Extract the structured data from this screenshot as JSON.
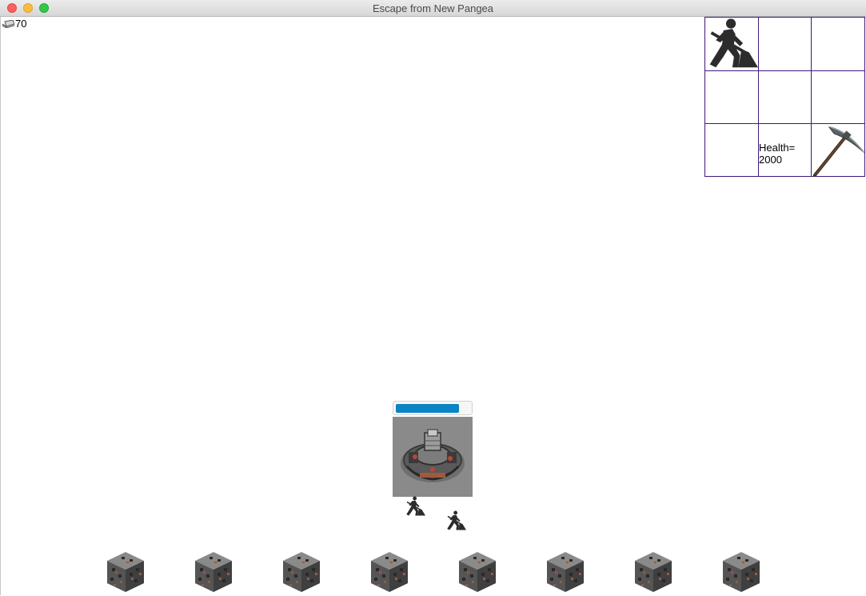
{
  "window": {
    "title": "Escape from New Pangea"
  },
  "hud": {
    "resource_icon": "metal-ingot-icon",
    "resource_count": "70"
  },
  "command_panel": {
    "worker_icon": "worker-shovel-icon",
    "health_label": "Health=",
    "health_value": "2000",
    "pickaxe_icon": "pickaxe-icon"
  },
  "base": {
    "health_fraction": 0.84,
    "bar_color": "#0a84c4",
    "image": "command-center-sprite"
  },
  "units": {
    "workers": [
      {
        "icon": "worker-shovel-icon"
      },
      {
        "icon": "worker-shovel-icon"
      }
    ]
  },
  "ore_blocks": [
    {
      "icon": "ore-block-icon"
    },
    {
      "icon": "ore-block-icon"
    },
    {
      "icon": "ore-block-icon"
    },
    {
      "icon": "ore-block-icon"
    },
    {
      "icon": "ore-block-icon"
    },
    {
      "icon": "ore-block-icon"
    },
    {
      "icon": "ore-block-icon"
    },
    {
      "icon": "ore-block-icon"
    }
  ],
  "colors": {
    "grid_border": "#3c1a78",
    "base_bg": "#8a8a8a",
    "ore_dark": "#3a3a3a"
  }
}
